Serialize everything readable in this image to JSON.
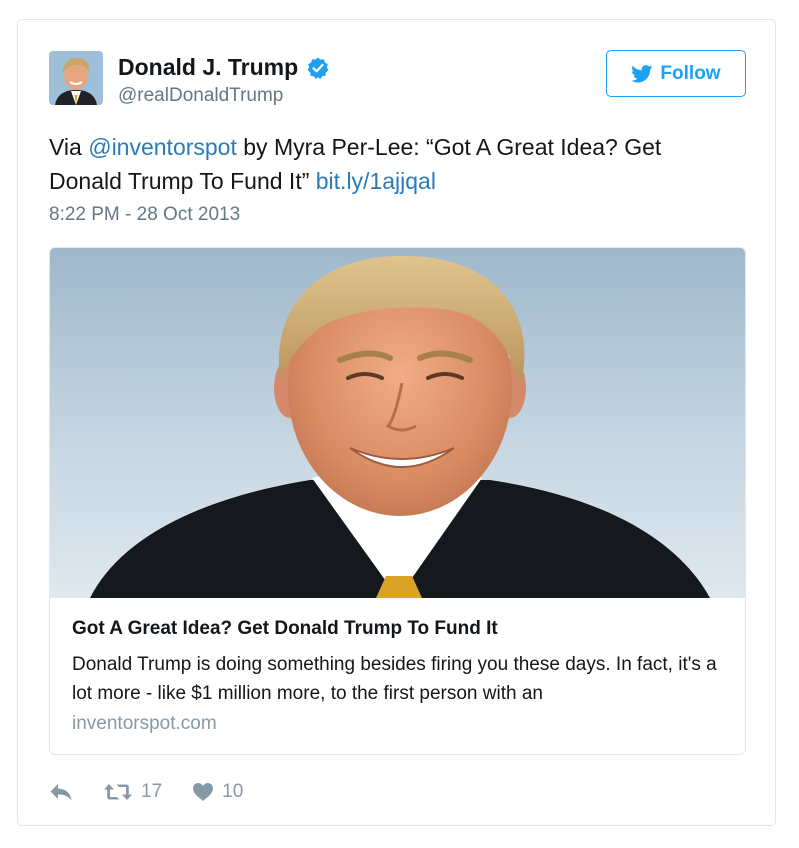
{
  "user": {
    "display_name": "Donald J. Trump",
    "screen_name": "@realDonaldTrump",
    "verified": true
  },
  "follow_button": {
    "label": "Follow",
    "icon": "twitter-bird-icon"
  },
  "tweet": {
    "prefix": "Via ",
    "mention": "@inventorspot",
    "body": " by Myra Per-Lee: “Got A Great Idea? Get Donald Trump To Fund It” ",
    "link": "bit.ly/1ajjqal",
    "timestamp": "8:22 PM - 28 Oct 2013"
  },
  "link_card": {
    "title": "Got A Great Idea? Get Donald Trump To Fund It",
    "description": "Donald Trump is doing something besides firing you these days.  In fact, it's a lot more - like $1 million more, to the first person with an",
    "domain": "inventorspot.com"
  },
  "actions": {
    "reply_icon": "reply-icon",
    "retweet_icon": "retweet-icon",
    "retweet_count": "17",
    "like_icon": "heart-icon",
    "like_count": "10"
  },
  "colors": {
    "accent": "#1da1f2",
    "link": "#2b7bb9",
    "muted": "#657786",
    "border": "#e1e8ed"
  }
}
